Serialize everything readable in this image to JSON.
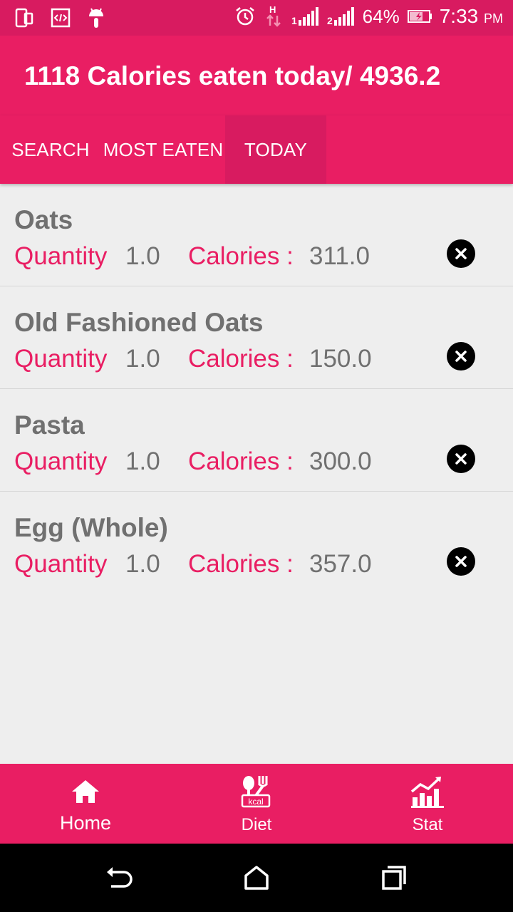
{
  "status_bar": {
    "battery_percent": "64%",
    "time": "7:33",
    "ampm": "PM",
    "icons": [
      "phone-icon",
      "code-icon",
      "android-icon",
      "alarm-icon",
      "data-h-icon",
      "signal-1-icon",
      "signal-2-icon",
      "battery-icon"
    ]
  },
  "app_bar": {
    "title": "1118 Calories eaten today/ 4936.2"
  },
  "tabs": [
    {
      "label": "SEARCH",
      "selected": false
    },
    {
      "label": "MOST EATEN",
      "selected": false
    },
    {
      "label": "TODAY",
      "selected": true
    }
  ],
  "items": [
    {
      "name": "Oats",
      "quantity_label": "Quantity",
      "quantity": "1.0",
      "calories_label": "Calories :",
      "calories": "311.0"
    },
    {
      "name": "Old Fashioned Oats",
      "quantity_label": "Quantity",
      "quantity": "1.0",
      "calories_label": "Calories :",
      "calories": "150.0"
    },
    {
      "name": "Pasta",
      "quantity_label": "Quantity",
      "quantity": "1.0",
      "calories_label": "Calories :",
      "calories": "300.0"
    },
    {
      "name": "Egg (Whole)",
      "quantity_label": "Quantity",
      "quantity": "1.0",
      "calories_label": "Calories :",
      "calories": "357.0"
    }
  ],
  "bottom_nav": [
    {
      "label": "Home",
      "icon": "home-icon"
    },
    {
      "label": "Diet",
      "icon": "diet-kcal-icon",
      "icon_text": "kcal"
    },
    {
      "label": "Stat",
      "icon": "stat-chart-icon"
    }
  ],
  "colors": {
    "primary": "#e91e63",
    "primary_dark": "#d81b60",
    "text_gray": "#707070",
    "background": "#eeeeee"
  }
}
